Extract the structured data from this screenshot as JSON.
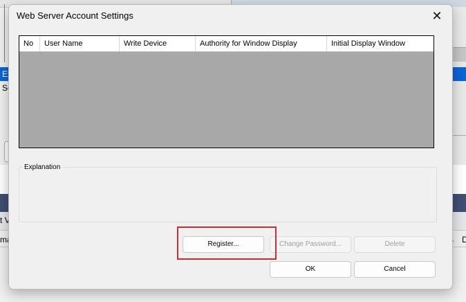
{
  "background": {
    "selected_row_prefix": "Ex",
    "row_prefix": "Se",
    "tab_fragment": "t V",
    "column_fragment": "ma",
    "right_fragment_s": "s",
    "right_fragment_d": "D",
    "selection_color": "#0a64d6",
    "band_color": "#3e4f73"
  },
  "dialog": {
    "title": "Web Server Account Settings",
    "close_icon": "close-icon",
    "table": {
      "columns": [
        "No",
        "User Name",
        "Write Device",
        "Authority for Window Display",
        "Initial Display Window"
      ],
      "rows": [],
      "empty_background": "#a8a8a8"
    },
    "explanation": {
      "label": "Explanation",
      "text": ""
    },
    "buttons": {
      "register": "Register...",
      "change_password": "Change Password...",
      "delete": "Delete",
      "ok": "OK",
      "cancel": "Cancel"
    },
    "highlight_color": "#d32a2a"
  }
}
